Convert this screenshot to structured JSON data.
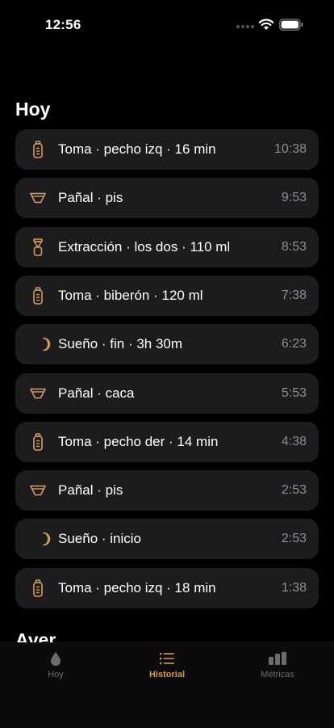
{
  "status_bar": {
    "time": "12:56"
  },
  "colors": {
    "accent": "#d39b5f",
    "row_bg": "#1c1c1e",
    "time_gray": "#8e8e93",
    "tab_inactive": "#6c6c70"
  },
  "sections": [
    {
      "title": "Hoy"
    },
    {
      "title": "Ayer"
    }
  ],
  "entries": [
    {
      "icon": "bottle-icon",
      "label": "Toma · pecho izq · 16 min",
      "time": "10:38"
    },
    {
      "icon": "diaper-icon",
      "label": "Pañal · pis",
      "time": "9:53"
    },
    {
      "icon": "pump-icon",
      "label": "Extracción · los dos · 110 ml",
      "time": "8:53"
    },
    {
      "icon": "bottle-icon",
      "label": "Toma · biberón · 120 ml",
      "time": "7:38"
    },
    {
      "icon": "moon-icon",
      "label": "Sueño · fin · 3h 30m",
      "time": "6:23"
    },
    {
      "icon": "diaper-icon",
      "label": "Pañal · caca",
      "time": "5:53"
    },
    {
      "icon": "bottle-icon",
      "label": "Toma · pecho der · 14 min",
      "time": "4:38"
    },
    {
      "icon": "diaper-icon",
      "label": "Pañal · pis",
      "time": "2:53"
    },
    {
      "icon": "moon-icon",
      "label": "Sueño · inicio",
      "time": "2:53"
    },
    {
      "icon": "bottle-icon",
      "label": "Toma · pecho izq · 18 min",
      "time": "1:38"
    }
  ],
  "tabs": [
    {
      "label": "Hoy",
      "icon": "drop-icon",
      "active": false
    },
    {
      "label": "Historial",
      "icon": "list-icon",
      "active": true
    },
    {
      "label": "Métricas",
      "icon": "bar-chart-icon",
      "active": false
    }
  ]
}
